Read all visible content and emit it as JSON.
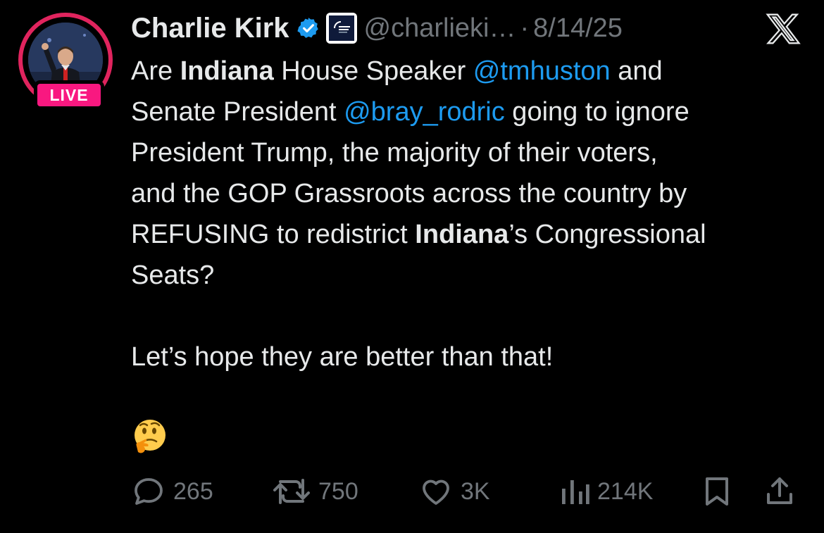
{
  "author": {
    "name": "Charlie Kirk",
    "handle": "@charlieki…",
    "separator": "·",
    "date": "8/14/25",
    "live_label": "LIVE",
    "verified_color": "#1d9bf0",
    "live_color": "#f91880"
  },
  "tweet": {
    "line1": {
      "a": "Are ",
      "b": "Indiana",
      "c": " House Speaker ",
      "mention": "@tmhuston",
      "d": " and"
    },
    "line2": {
      "a": "Senate President ",
      "mention": "@bray_rodric",
      "b": " going to ignore"
    },
    "line3": "President Trump, the majority of their voters,",
    "line4": "and the GOP Grassroots across the country by",
    "line5": {
      "a": "REFUSING to redistrict ",
      "b": "Indiana",
      "c": "’s Congressional"
    },
    "line6": "Seats?",
    "line7": "Let’s hope they are better than that!",
    "emoji": "thinking-face-emoji"
  },
  "actions": {
    "replies": "265",
    "reposts": "750",
    "likes": "3K",
    "views": "214K"
  },
  "icons": [
    "verified-badge-icon",
    "affiliate-org-icon",
    "x-logo-icon",
    "reply-icon",
    "repost-icon",
    "like-icon",
    "views-icon",
    "bookmark-icon",
    "share-icon"
  ]
}
